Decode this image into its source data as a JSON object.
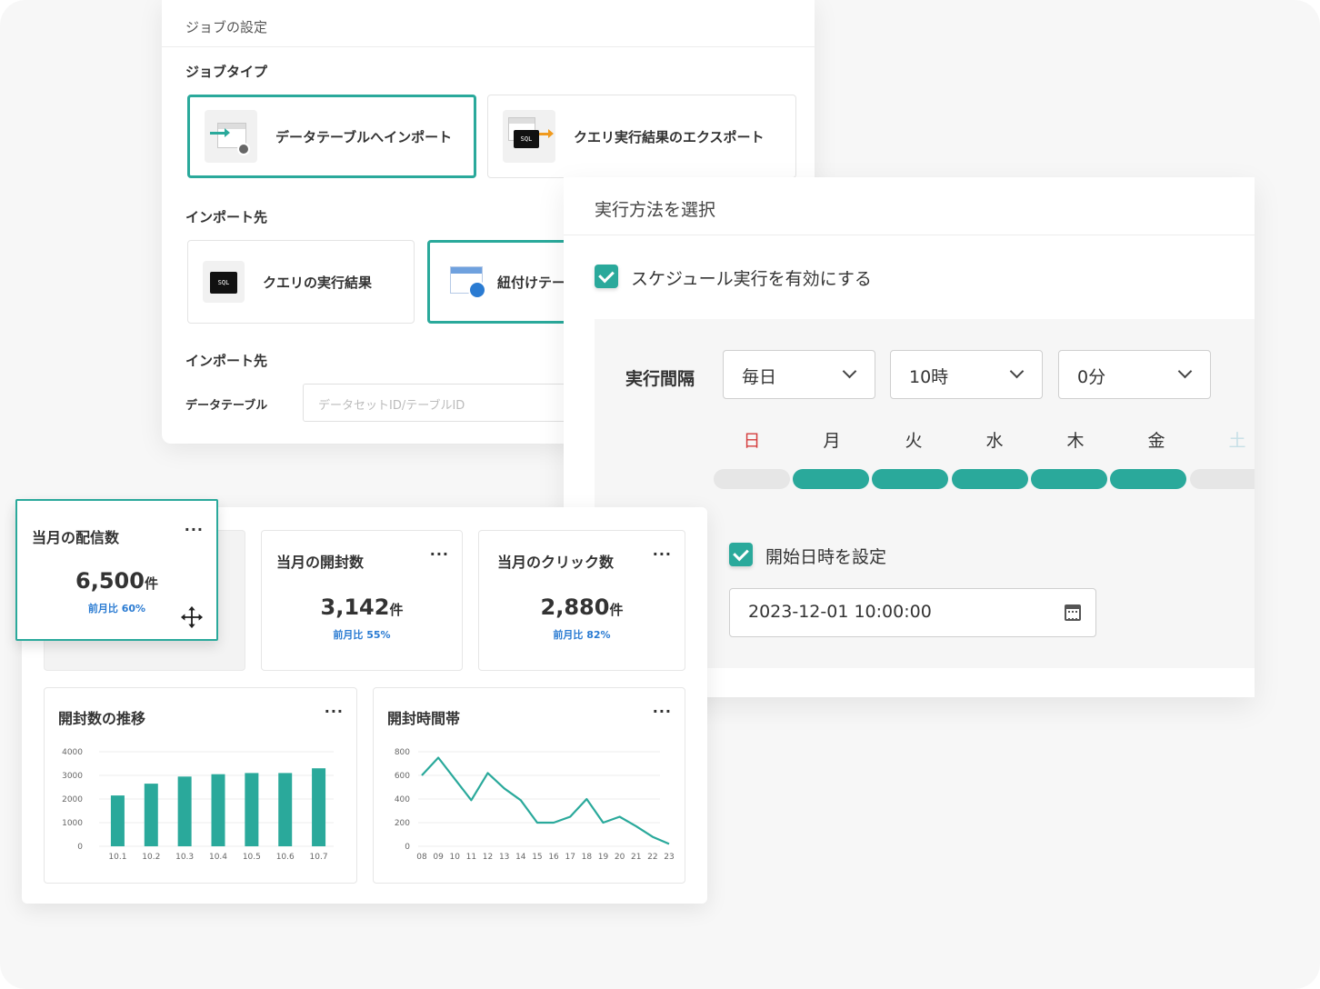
{
  "job": {
    "title": "ジョブの設定",
    "type_label": "ジョブタイプ",
    "type_options": [
      "データテーブルへインポート",
      "クエリ実行結果のエクスポート"
    ],
    "import_from_label": "インポート先",
    "source_options": [
      "クエリの実行結果",
      "紐付けテー"
    ],
    "import_to_label": "インポート先",
    "field_label": "データテーブル",
    "field_placeholder": "データセットID/テーブルID",
    "sql_badge": "SQL"
  },
  "run": {
    "title": "実行方法を選択",
    "schedule_checkbox": "スケジュール実行を有効にする",
    "interval_label": "実行間隔",
    "frequency": "毎日",
    "hour": "10時",
    "minute": "0分",
    "days": [
      "日",
      "月",
      "火",
      "水",
      "木",
      "金",
      "土"
    ],
    "days_active": [
      false,
      true,
      true,
      true,
      true,
      true,
      false
    ],
    "start_checkbox": "開始日時を設定",
    "start_value": "2023-12-01 10:00:00"
  },
  "dashboard": {
    "menu_glyph": "···",
    "metrics": [
      {
        "title": "当月の配信数",
        "value": "6,500",
        "unit": "件",
        "ratio": "前月比 60%"
      },
      {
        "title": "当月の開封数",
        "value": "3,142",
        "unit": "件",
        "ratio": "前月比 55%"
      },
      {
        "title": "当月のクリック数",
        "value": "2,880",
        "unit": "件",
        "ratio": "前月比 82%"
      }
    ],
    "charts": [
      {
        "title": "開封数の推移"
      },
      {
        "title": "開封時間帯"
      }
    ]
  },
  "colors": {
    "accent": "#2aa99b",
    "link": "#2a7bd2",
    "sunday": "#d43c3c"
  },
  "chart_data": [
    {
      "type": "bar",
      "title": "開封数の推移",
      "categories": [
        "10.1",
        "10.2",
        "10.3",
        "10.4",
        "10.5",
        "10.6",
        "10.7"
      ],
      "values": [
        2150,
        2650,
        2950,
        3050,
        3100,
        3100,
        3300
      ],
      "yticks": [
        "0",
        "1000",
        "2000",
        "3000",
        "4000"
      ],
      "ylim": [
        0,
        4000
      ]
    },
    {
      "type": "line",
      "title": "開封時間帯",
      "x": [
        "08",
        "09",
        "10",
        "11",
        "12",
        "13",
        "14",
        "15",
        "16",
        "17",
        "18",
        "19",
        "20",
        "21",
        "22",
        "23"
      ],
      "values": [
        600,
        750,
        570,
        390,
        620,
        490,
        390,
        200,
        200,
        250,
        400,
        200,
        250,
        170,
        80,
        20
      ],
      "yticks": [
        "0",
        "200",
        "400",
        "600",
        "800"
      ],
      "ylim": [
        0,
        800
      ]
    }
  ]
}
